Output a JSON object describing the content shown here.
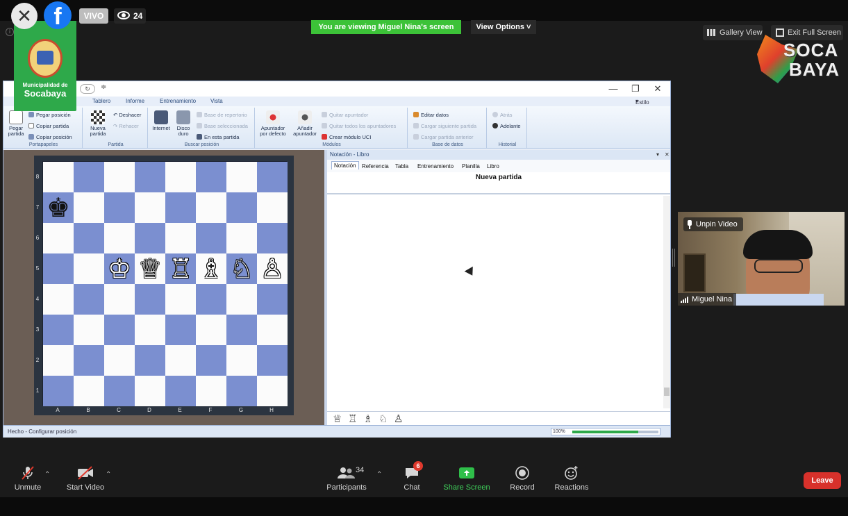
{
  "overlay": {
    "vivo_label": "VIVO",
    "viewer_count": "24",
    "sponsor_line1": "Municipalidad de",
    "sponsor_line2": "Socabaya",
    "logo_text1": "SOCA",
    "logo_text2": "BAYA"
  },
  "zoom": {
    "viewing_banner": "You are viewing Miguel Nina's screen",
    "view_options": "View Options ˅",
    "gallery_view": "Gallery View",
    "exit_full_screen": "Exit Full Screen",
    "unpin_video": "Unpin Video",
    "participant_name": "Miguel Nina",
    "toolbar": {
      "unmute": "Unmute",
      "start_video": "Start Video",
      "participants": "Participants",
      "participants_count": "34",
      "chat": "Chat",
      "chat_badge": "6",
      "share_screen": "Share Screen",
      "record": "Record",
      "reactions": "Reactions",
      "leave": "Leave"
    }
  },
  "app": {
    "menu": [
      "Tablero",
      "Informe",
      "Entrenamiento",
      "Vista"
    ],
    "estilo": "Estilo",
    "ribbon": {
      "portapapeles": {
        "label": "Portapapeles",
        "pegar_partida": "Pegar partida",
        "pegar_posicion": "Pegar posición",
        "copiar_partida": "Copiar partida",
        "copiar_posicion": "Copiar posición"
      },
      "partida": {
        "label": "Partida",
        "nueva_partida": "Nueva partida",
        "deshacer": "Deshacer",
        "rehacer": "Rehacer"
      },
      "buscar_posicion": {
        "label": "Buscar posición",
        "internet": "Internet",
        "disco_duro": "Disco duro",
        "base_repertorio": "Base de repertorio",
        "base_seleccionada": "Base seleccionada",
        "en_esta_partida": "En esta partida"
      },
      "modulos": {
        "label": "Módulos",
        "apuntador_defecto": "Apuntador por defecto",
        "anadir_apuntador": "Añadir apuntador",
        "quitar_apuntador": "Quitar apuntador",
        "quitar_todos": "Quitar todos los apuntadores",
        "crear_modulo": "Crear módulo UCI"
      },
      "base_datos": {
        "label": "Base de datos",
        "editar_datos": "Editar datos",
        "cargar_siguiente": "Cargar siguiente partida",
        "cargar_anterior": "Cargar partida anterior"
      },
      "historial": {
        "label": "Historial",
        "atras": "Atrás",
        "adelante": "Adelante"
      }
    },
    "board": {
      "ranks": [
        "8",
        "7",
        "6",
        "5",
        "4",
        "3",
        "2",
        "1"
      ],
      "files": [
        "A",
        "B",
        "C",
        "D",
        "E",
        "F",
        "G",
        "H"
      ],
      "pieces": {
        "a7": "♚",
        "c5": "♔",
        "d5": "♕",
        "e5": "♖",
        "f5": "♗",
        "g5": "♘",
        "h5": "♙"
      },
      "piece_colors": {
        "a7": "b",
        "c5": "w",
        "d5": "w",
        "e5": "w",
        "f5": "w",
        "g5": "w",
        "h5": "w"
      }
    },
    "notation": {
      "header": "Notación - Libro",
      "tabs": [
        "Notación",
        "Referencia",
        "Tabla",
        "Entrenamiento",
        "Planilla",
        "Libro"
      ],
      "title": "Nueva partida",
      "piece_palette": [
        "♕",
        "♖",
        "♗",
        "♘",
        "♙"
      ]
    },
    "status": {
      "text": "Hecho - Configurar posición",
      "zoom": "100%",
      "zoom_fraction": 0.77
    }
  }
}
